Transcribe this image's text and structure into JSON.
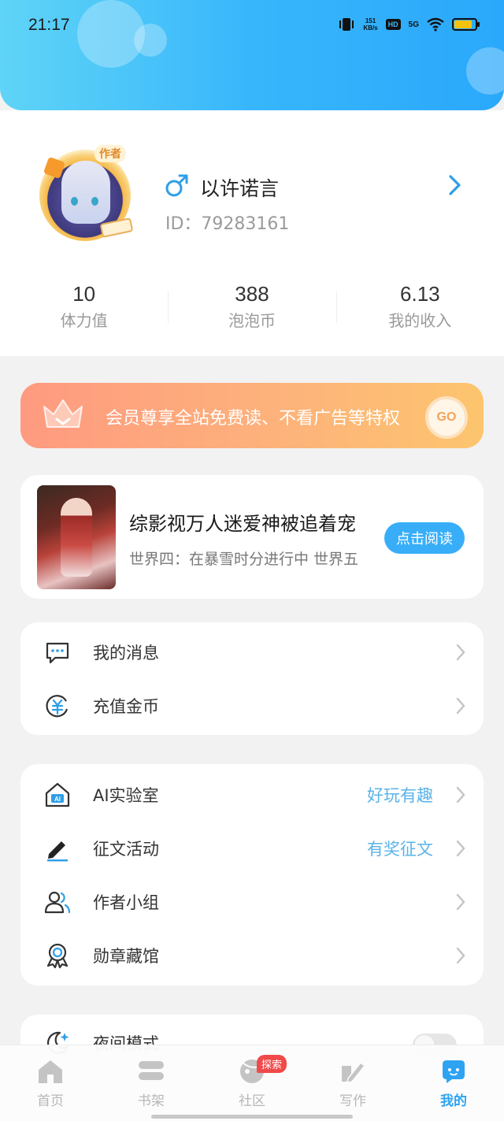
{
  "status_bar": {
    "time": "21:17",
    "net_speed_value": "151",
    "net_speed_unit": "KB/s",
    "hd": "HD",
    "signal": "5G",
    "icons": [
      "vibrate-icon",
      "hd-icon",
      "5g-signal-icon",
      "wifi-icon",
      "battery-icon"
    ]
  },
  "profile": {
    "avatar_tag": "作者",
    "gender_icon": "male-icon",
    "username": "以许诺言",
    "id_text": "ID：79283161",
    "stats": [
      {
        "value": "10",
        "label": "体力值"
      },
      {
        "value": "388",
        "label": "泡泡币"
      },
      {
        "value": "6.13",
        "label": "我的收入"
      }
    ]
  },
  "vip_banner": {
    "text": "会员尊享全站免费读、不看广告等特权",
    "go_label": "GO"
  },
  "book": {
    "title": "综影视万人迷爱神被追着宠",
    "subtitle": "世界四：在暴雪时分进行中 世界五",
    "read_label": "点击阅读"
  },
  "menu_group_1": [
    {
      "icon": "message-icon",
      "label": "我的消息"
    },
    {
      "icon": "coin-recharge-icon",
      "label": "充值金币"
    }
  ],
  "menu_group_2": [
    {
      "icon": "ai-lab-icon",
      "label": "AI实验室",
      "extra": "好玩有趣"
    },
    {
      "icon": "pen-icon",
      "label": "征文活动",
      "extra": "有奖征文"
    },
    {
      "icon": "author-group-icon",
      "label": "作者小组",
      "extra": ""
    },
    {
      "icon": "medal-icon",
      "label": "勋章藏馆",
      "extra": ""
    }
  ],
  "menu_group_3": [
    {
      "icon": "night-mode-icon",
      "label": "夜间模式",
      "toggle_on": false
    }
  ],
  "bottom_nav": [
    {
      "label": "首页",
      "icon": "home-icon"
    },
    {
      "label": "书架",
      "icon": "bookshelf-icon"
    },
    {
      "label": "社区",
      "icon": "community-icon",
      "badge": "探索"
    },
    {
      "label": "写作",
      "icon": "write-icon"
    },
    {
      "label": "我的",
      "icon": "mine-icon",
      "active": true
    }
  ],
  "colors": {
    "accent": "#2ea3f2",
    "header_gradient_start": "#5fd4f7",
    "header_gradient_end": "#2aa8fb",
    "vip_gradient_start": "#fe9a80",
    "vip_gradient_end": "#fdc56e",
    "badge_red": "#f04a4a"
  }
}
